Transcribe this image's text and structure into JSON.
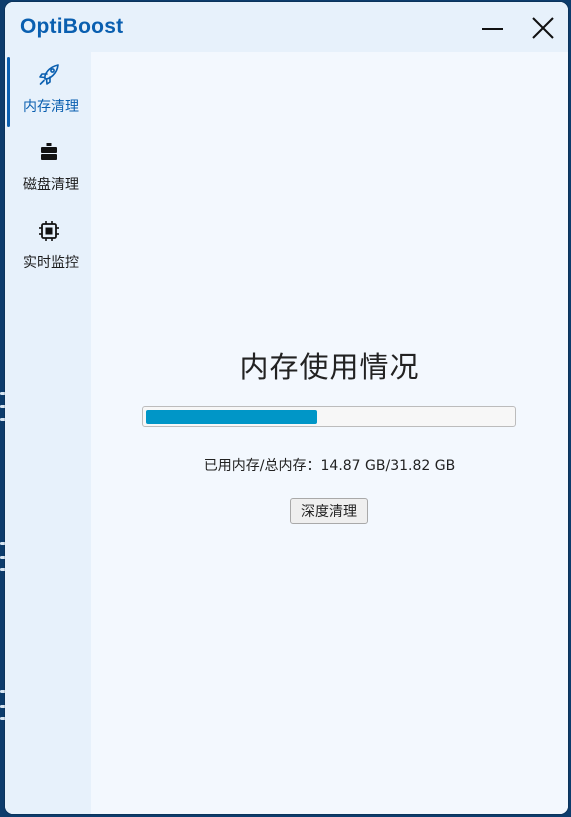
{
  "window": {
    "title": "OptiBoost",
    "minimize_icon": "minimize-icon",
    "close_icon": "close-icon"
  },
  "sidebar": {
    "items": [
      {
        "label": "内存清理",
        "icon": "rocket-icon",
        "active": true
      },
      {
        "label": "磁盘清理",
        "icon": "disk-icon",
        "active": false
      },
      {
        "label": "实时监控",
        "icon": "chip-icon",
        "active": false
      }
    ]
  },
  "main": {
    "title": "内存使用情况",
    "memory_used": "14.87 GB",
    "memory_total": "31.82 GB",
    "memory_label": "已用内存/总内存：14.87 GB/31.82 GB",
    "progress_fraction": 0.467,
    "deep_clean_label": "深度清理"
  },
  "colors": {
    "accent": "#0a5fb0",
    "progress": "#0096c7",
    "sidebar_bg": "#e7f1fb",
    "content_bg": "#f3f8fe"
  }
}
